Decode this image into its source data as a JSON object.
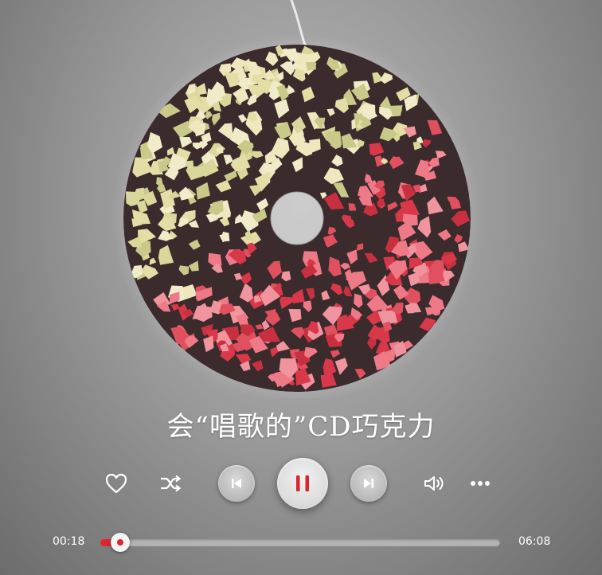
{
  "track": {
    "title": "会“唱歌的”CD巧克力",
    "elapsed": "00:18",
    "duration": "06:08",
    "progress_fraction": 0.05
  },
  "controls": {
    "like": "heart-icon",
    "shuffle": "shuffle-icon",
    "previous": "skip-previous-icon",
    "play_pause": "pause-icon",
    "next": "skip-next-icon",
    "volume": "volume-icon",
    "more": "more-dots-icon"
  },
  "colors": {
    "accent": "#e0262c",
    "chocolate": "#3b2b2d",
    "pale_chips": "#ddd7a0",
    "red_chips": "#e0505e"
  }
}
